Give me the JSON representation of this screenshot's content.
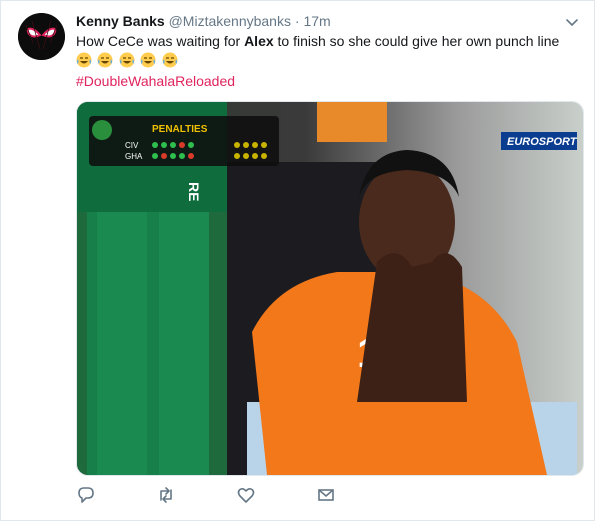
{
  "tweet": {
    "author_name": "Kenny Banks",
    "author_handle": "@Miztakennybanks",
    "separator": "·",
    "time_ago": "17m",
    "text_before": "How CeCe was waiting for ",
    "text_bold": "Alex",
    "text_after": " to finish so she could give her own punch line",
    "emoji_count": 5,
    "hashtag": "#DoubleWahalaReloaded"
  },
  "media": {
    "scoreboard_title": "PENALTIES",
    "team_1": "CIV",
    "team_2": "GHA",
    "channel_logo": "EUROSPORT",
    "jersey_number": "10",
    "shirt_text": "RE"
  },
  "actions": [
    "reply-icon",
    "retweet-icon",
    "like-icon",
    "message-icon"
  ],
  "colors": {
    "hashtag": "#e0245e",
    "secondary_text": "#657786",
    "jersey": "#f2781a"
  }
}
